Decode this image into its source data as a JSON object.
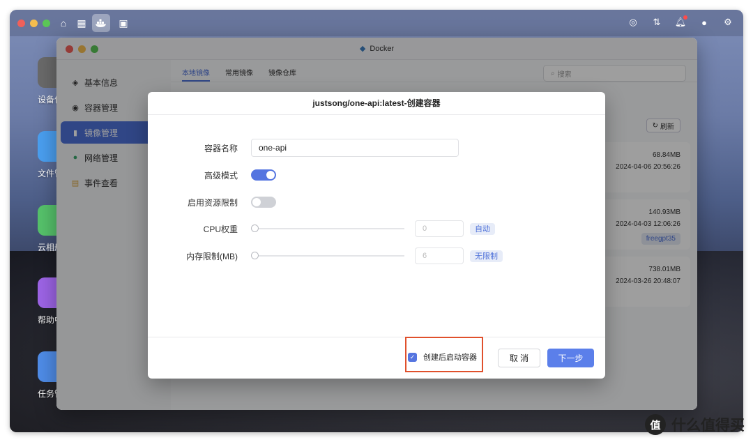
{
  "desktop": {
    "icons": [
      {
        "label": "设备信息",
        "color": "#6a6a6a"
      },
      {
        "label": "文件管",
        "color": "#4a9ff0"
      },
      {
        "label": "云相册",
        "color": "#56c26b"
      },
      {
        "label": "帮助中",
        "color": "#9d64e6"
      },
      {
        "label": "任务管",
        "color": "#4f8ce7"
      }
    ]
  },
  "taskbar": {
    "left_icons": [
      "home-icon",
      "apps-grid-icon",
      "docker-icon",
      "terminal-icon"
    ],
    "right_icons": [
      "globe-icon",
      "transfer-icon",
      "bell-icon",
      "user-icon",
      "settings-icon"
    ]
  },
  "docker_window": {
    "title": "Docker",
    "sidebar": [
      {
        "label": "基本信息",
        "icon": "info-icon"
      },
      {
        "label": "容器管理",
        "icon": "container-icon"
      },
      {
        "label": "镜像管理",
        "icon": "image-icon",
        "active": true
      },
      {
        "label": "网络管理",
        "icon": "network-icon"
      },
      {
        "label": "事件查看",
        "icon": "event-icon"
      }
    ],
    "tabs": [
      "本地镜像",
      "常用镜像",
      "镜像仓库"
    ],
    "search_placeholder": "搜索",
    "refresh_label": "刷新",
    "images": [
      {
        "size": "68.84MB",
        "date": "2024-04-06 20:56:26",
        "tag": ""
      },
      {
        "size": "140.93MB",
        "date": "2024-04-03 12:06:26",
        "tag": "freegpt35"
      },
      {
        "size": "738.01MB",
        "date": "2024-03-26 20:48:07",
        "tag": ""
      }
    ]
  },
  "modal": {
    "title": "justsong/one-api:latest-创建容器",
    "container_name_label": "容器名称",
    "container_name_value": "one-api",
    "advanced_mode_label": "高级模式",
    "advanced_mode_on": true,
    "resource_limit_label": "启用资源限制",
    "resource_limit_on": false,
    "cpu_label": "CPU权重",
    "cpu_value": "0",
    "cpu_tag": "自动",
    "memory_label": "内存限制(MB)",
    "memory_value": "6",
    "memory_tag": "无限制",
    "start_after_create_label": "创建后启动容器",
    "start_after_create_checked": true,
    "cancel_label": "取 消",
    "next_label": "下一步"
  },
  "watermark": {
    "symbol": "值",
    "text": "什么值得买"
  },
  "colors": {
    "accent": "#5575e0",
    "highlight": "#e0502c"
  }
}
